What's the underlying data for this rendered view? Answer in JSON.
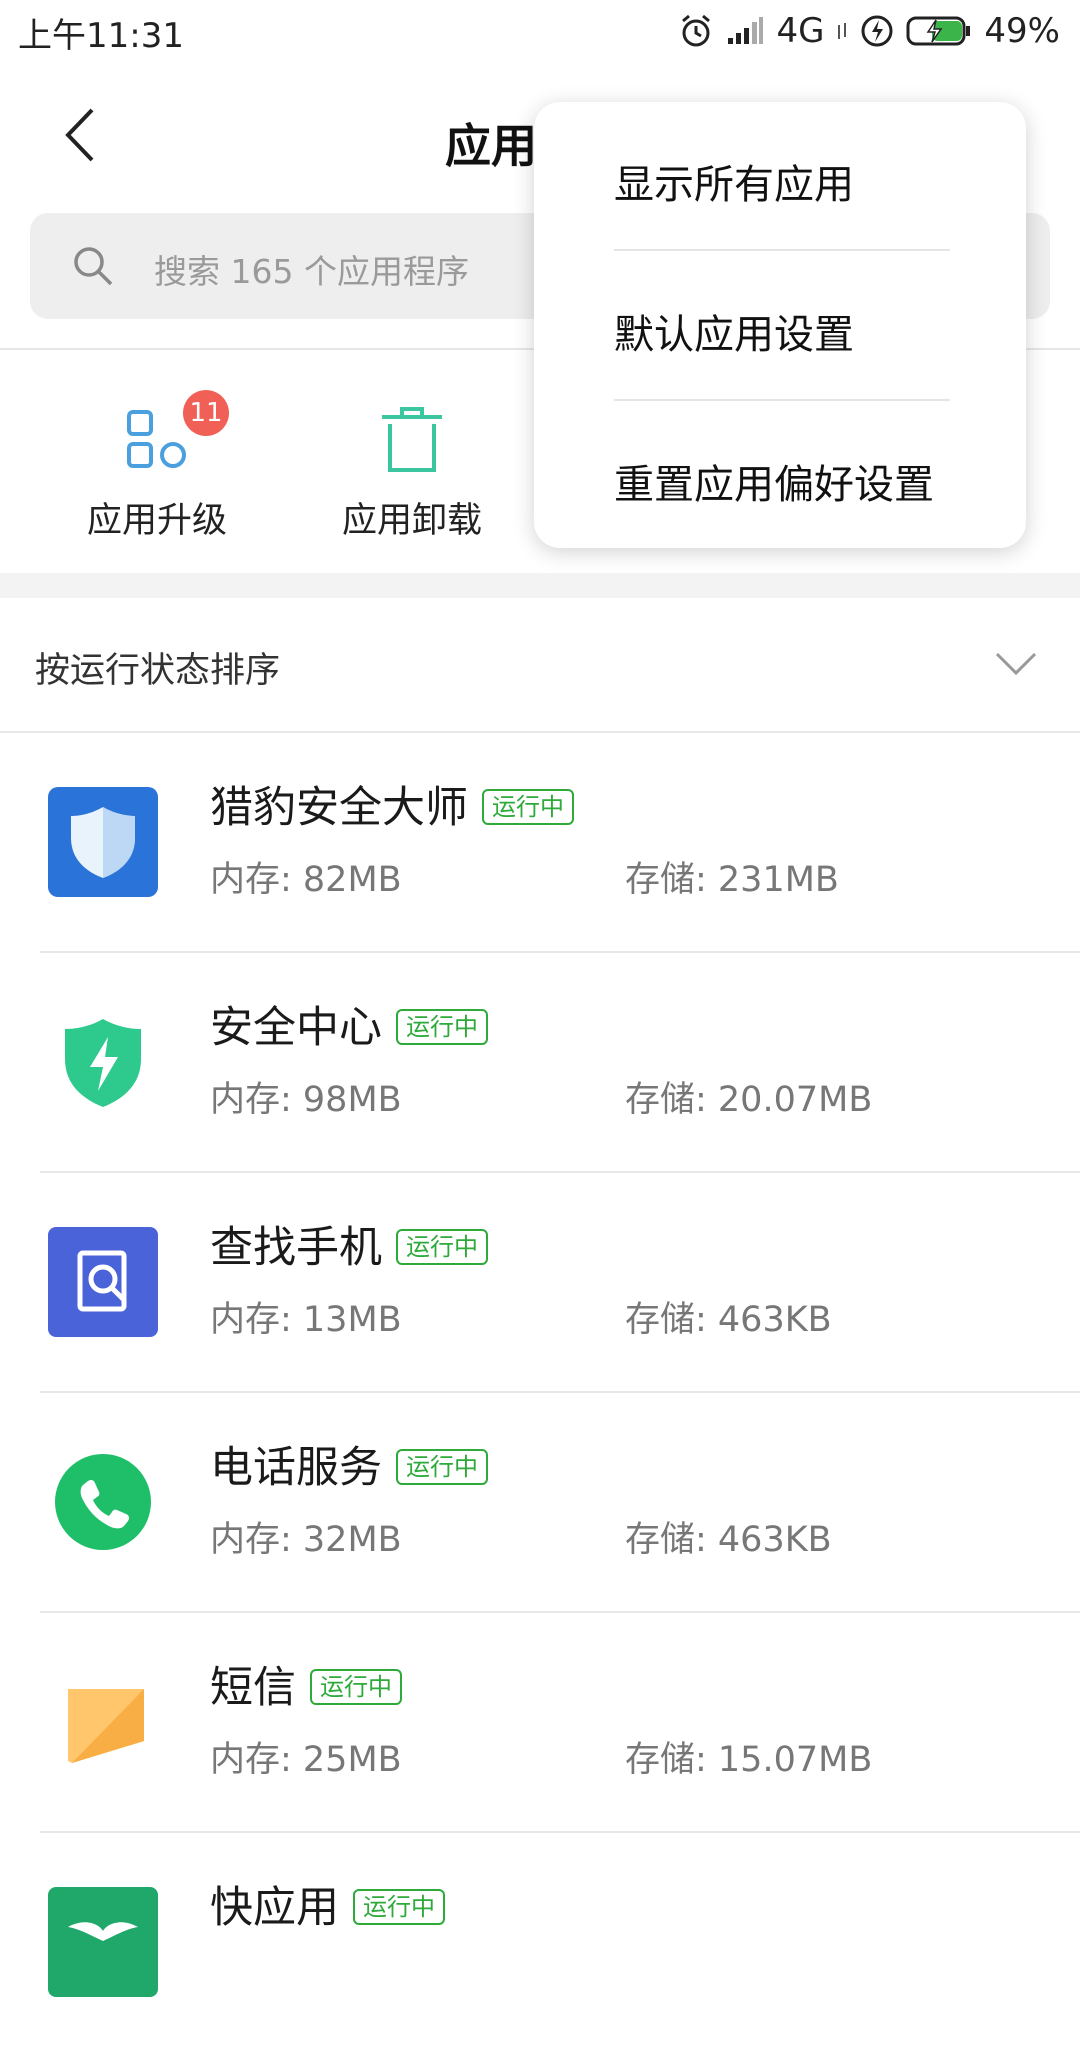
{
  "status_bar": {
    "time": "上午11:31",
    "network": "4G",
    "battery": "49%",
    "icons": [
      "alarm-icon",
      "signal-icon",
      "data-arrows-icon",
      "lightning-icon",
      "battery-charging-icon"
    ]
  },
  "header": {
    "title": "应用",
    "back_icon": "chevron-left-icon"
  },
  "search": {
    "placeholder": "搜索 165 个应用程序"
  },
  "shortcuts": [
    {
      "label": "应用升级",
      "icon": "apps-grid-icon",
      "badge": "11",
      "color": "#4a9fdf"
    },
    {
      "label": "应用卸载",
      "icon": "trash-icon",
      "color": "#3cc6a0"
    }
  ],
  "sort": {
    "label": "按运行状态排序"
  },
  "apps": [
    {
      "name": "猎豹安全大师",
      "status": "运行中",
      "memory": "内存: 82MB",
      "storage": "存储: 231MB",
      "icon": "shield-icon"
    },
    {
      "name": "安全中心",
      "status": "运行中",
      "memory": "内存: 98MB",
      "storage": "存储: 20.07MB",
      "icon": "security-bolt-icon"
    },
    {
      "name": "查找手机",
      "status": "运行中",
      "memory": "内存: 13MB",
      "storage": "存储: 463KB",
      "icon": "find-phone-icon"
    },
    {
      "name": "电话服务",
      "status": "运行中",
      "memory": "内存: 32MB",
      "storage": "存储: 463KB",
      "icon": "phone-icon"
    },
    {
      "name": "短信",
      "status": "运行中",
      "memory": "内存: 25MB",
      "storage": "存储: 15.07MB",
      "icon": "message-icon"
    },
    {
      "name": "快应用",
      "status": "运行中",
      "memory": "",
      "storage": "",
      "icon": "quick-app-icon"
    }
  ],
  "popup_menu": {
    "items": [
      "显示所有应用",
      "默认应用设置",
      "重置应用偏好设置"
    ]
  },
  "colors": {
    "running_green": "#2eaa3a",
    "badge_red": "#f06057"
  }
}
